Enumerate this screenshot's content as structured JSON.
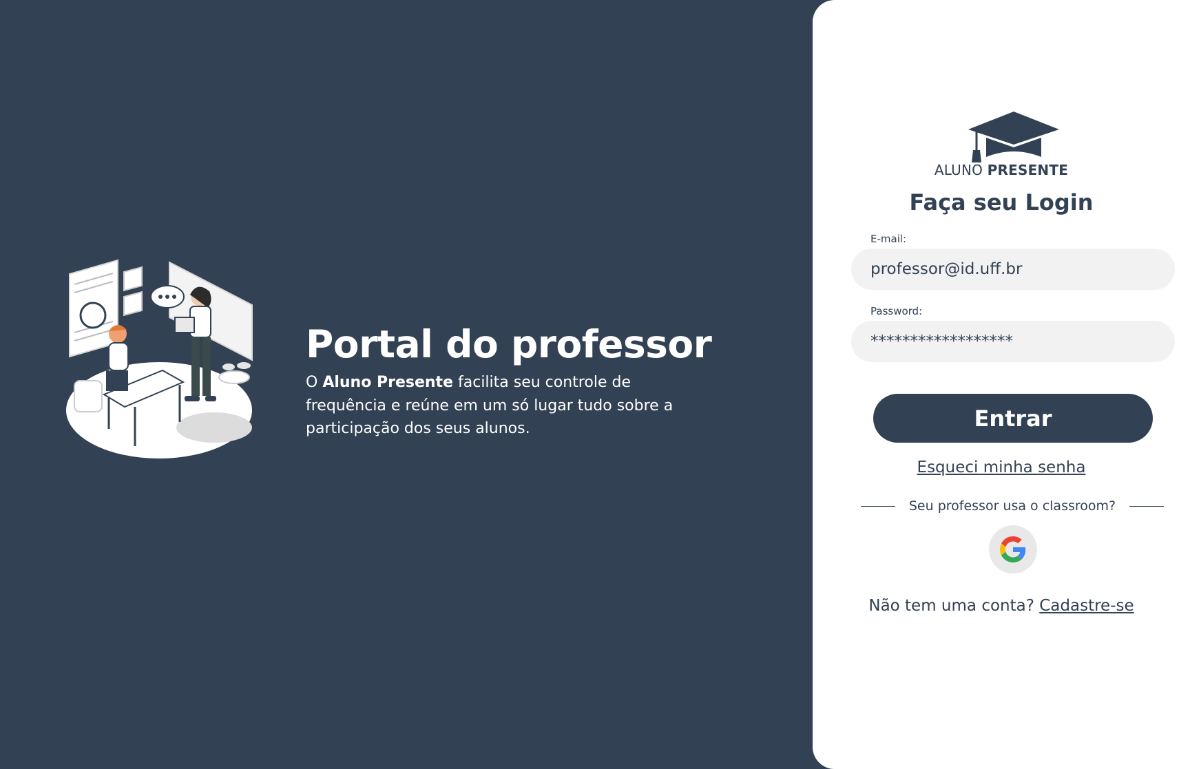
{
  "hero": {
    "title": "Portal do professor",
    "description_prefix": "O ",
    "brand": "Aluno Presente",
    "description_rest": " facilita seu controle de frequência e reúne em um só lugar tudo sobre a participação dos seus alunos.",
    "illustration_icon": "teacher-student-illustration"
  },
  "logo": {
    "icon": "graduation-cap-icon",
    "text_light": "ALUNO ",
    "text_bold": "PRESENTE"
  },
  "login": {
    "title": "Faça seu Login",
    "email_label": "E-mail:",
    "email_value": "professor@id.uff.br",
    "password_label": "Password:",
    "password_value": "******************",
    "submit_label": "Entrar",
    "forgot_label": "Esqueci minha senha",
    "classroom_prompt": "Seu professor usa o classroom?",
    "google_icon": "google-icon",
    "signup_prompt": "Não tem uma conta? ",
    "signup_link": "Cadastre-se"
  },
  "colors": {
    "background": "#324154",
    "panel": "#ffffff",
    "input_bg": "#f2f2f2",
    "google_bg": "#e8e8e8"
  }
}
